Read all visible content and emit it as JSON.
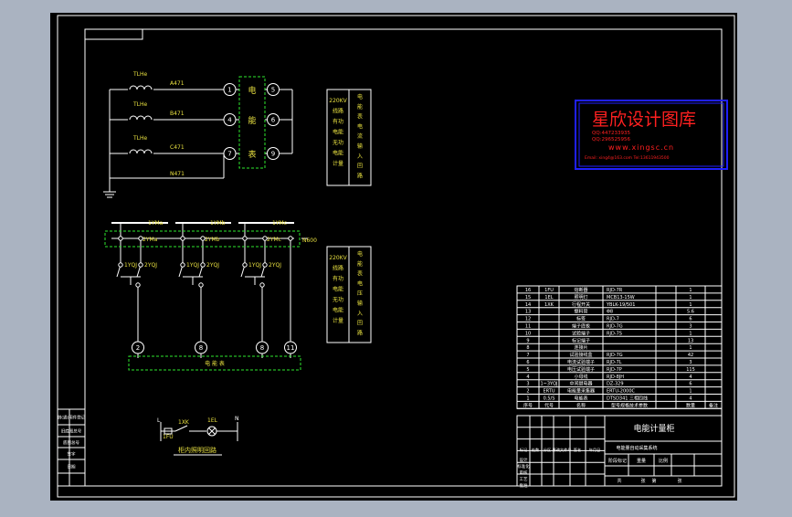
{
  "colors": {
    "background": "#aab3c1",
    "sheet": "#000000",
    "line": "#ffffff",
    "green": "#2ee82e",
    "yellow": "#e8e040",
    "cyan": "#40e0e8",
    "red": "#ff2020",
    "blue": "#2020ff"
  },
  "watermark": {
    "title": "星欣设计图库",
    "qq1": "QQ:447233935",
    "qq2": "QQ:296525956",
    "url": "www.xingsc.cn",
    "contact": "Email: xing4@163.com Tel:13611943500"
  },
  "upper_circuit": {
    "phases": [
      {
        "inductor": "TLHe",
        "label": "A471",
        "in": "1",
        "out": "5"
      },
      {
        "inductor": "TLHe",
        "label": "B471",
        "in": "4",
        "out": "6"
      },
      {
        "inductor": "TLHe",
        "label": "C471",
        "in": "7",
        "out": "9"
      }
    ],
    "neutral": "N471",
    "device_chars": [
      "电",
      "能",
      "表"
    ],
    "right_box_left": [
      "220KV",
      "线路",
      "有功",
      "电能",
      "无功",
      "电能",
      "计量"
    ],
    "right_box_right": [
      "电",
      "能",
      "表",
      "电",
      "流",
      "输",
      "入",
      "回",
      "路"
    ]
  },
  "lower_circuit": {
    "buses": [
      "1YMa",
      "1YMb",
      "1YMc"
    ],
    "sub_buses": [
      "2YMa",
      "2YMb",
      "2YMc"
    ],
    "switch_pairs": [
      [
        "1YQJ",
        "2YQJ"
      ],
      [
        "1YQJ",
        "2YQJ"
      ],
      [
        "1YQJ",
        "2YQJ"
      ]
    ],
    "extra_label": "N600",
    "terminals": [
      "2",
      "8",
      "8",
      "11"
    ],
    "device_label": "电 能 表",
    "right_box_left": [
      "220KV",
      "线路",
      "有功",
      "电能",
      "无功",
      "电能",
      "计量"
    ],
    "right_box_right": [
      "电",
      "能",
      "表",
      "电",
      "压",
      "输",
      "入",
      "回",
      "路"
    ]
  },
  "small_circuit": {
    "left": "L",
    "fuse": "1FU",
    "switch": "1XK",
    "lamp": "1EL",
    "right": "N",
    "caption": "柜内照明回路"
  },
  "bom": {
    "rows": [
      {
        "no": "16",
        "code": "1FU",
        "name": "熔断器",
        "spec": "RJD-7R",
        "qty": "1"
      },
      {
        "no": "15",
        "code": "1EL",
        "name": "照明灯",
        "spec": "MCB13-15W",
        "qty": "1"
      },
      {
        "no": "14",
        "code": "1XK",
        "name": "行程开关",
        "spec": "YBLK-19/501",
        "qty": "1"
      },
      {
        "no": "13",
        "code": "",
        "name": "塑料管",
        "spec": "Φ8",
        "qty": "5.6"
      },
      {
        "no": "12",
        "code": "",
        "name": "标签",
        "spec": "RJD-7",
        "qty": "6"
      },
      {
        "no": "11",
        "code": "",
        "name": "端子底板",
        "spec": "RJD-7G",
        "qty": "3"
      },
      {
        "no": "10",
        "code": "",
        "name": "试验端子",
        "spec": "RJD-7S",
        "qty": "1"
      },
      {
        "no": "9",
        "code": "",
        "name": "标记端子",
        "spec": "",
        "qty": "13"
      },
      {
        "no": "8",
        "code": "",
        "name": "连接片",
        "spec": "",
        "qty": "1"
      },
      {
        "no": "7",
        "code": "",
        "name": "试验接线盒",
        "spec": "RJD-7G",
        "qty": "42"
      },
      {
        "no": "6",
        "code": "",
        "name": "电流试验端子",
        "spec": "RJD-7L",
        "qty": "3"
      },
      {
        "no": "5",
        "code": "",
        "name": "电压试验端子",
        "spec": "RJD-7P",
        "qty": "115"
      },
      {
        "no": "4",
        "code": "",
        "name": "小母线",
        "spec": "RJD-8JH",
        "qty": "4"
      },
      {
        "no": "3",
        "code": "1~3YQJ",
        "name": "中间继电器",
        "spec": "DZ-329",
        "qty": "6"
      },
      {
        "no": "2",
        "code": "ERTU",
        "name": "电能量采集器",
        "spec": "ERTU-2000C",
        "qty": "1"
      },
      {
        "no": "1",
        "code": "0.5/S",
        "name": "电能表",
        "spec": "DTSD341 三相四线",
        "qty": "4"
      }
    ],
    "header": [
      "序号",
      "代号",
      "名称",
      "型号规格技术参数",
      "数量",
      "备注"
    ],
    "title": "电能计量柜",
    "company": "电能量自动采集系统",
    "sub_labels": [
      "标记",
      "处数",
      "分区",
      "更改文件号",
      "签名",
      "年月日"
    ],
    "design_labels": [
      "设计",
      "标准化",
      "审核",
      "工艺",
      "批准"
    ],
    "stage_labels": [
      "阶段标记",
      "重量",
      "比例"
    ],
    "sheet_info": [
      "共",
      "张",
      "第",
      "张"
    ]
  },
  "left_strip": [
    "借(通)用件登记",
    "旧底图总号",
    "底图总号",
    "签字",
    "日期"
  ]
}
